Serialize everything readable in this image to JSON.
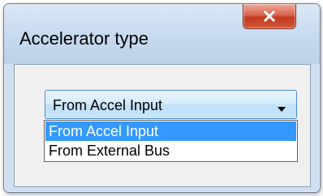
{
  "window": {
    "title": "Accelerator type",
    "close_label": "X"
  },
  "combo": {
    "selected_value": "From Accel Input",
    "options": [
      {
        "label": "From Accel Input",
        "highlighted": true
      },
      {
        "label": "From External Bus",
        "highlighted": false
      }
    ]
  },
  "colors": {
    "highlight": "#3399ff",
    "close_button": "#c4391f",
    "frame": "#cfdff0"
  },
  "icons": {
    "close": "close-icon",
    "dropdown": "chevron-down-icon"
  }
}
